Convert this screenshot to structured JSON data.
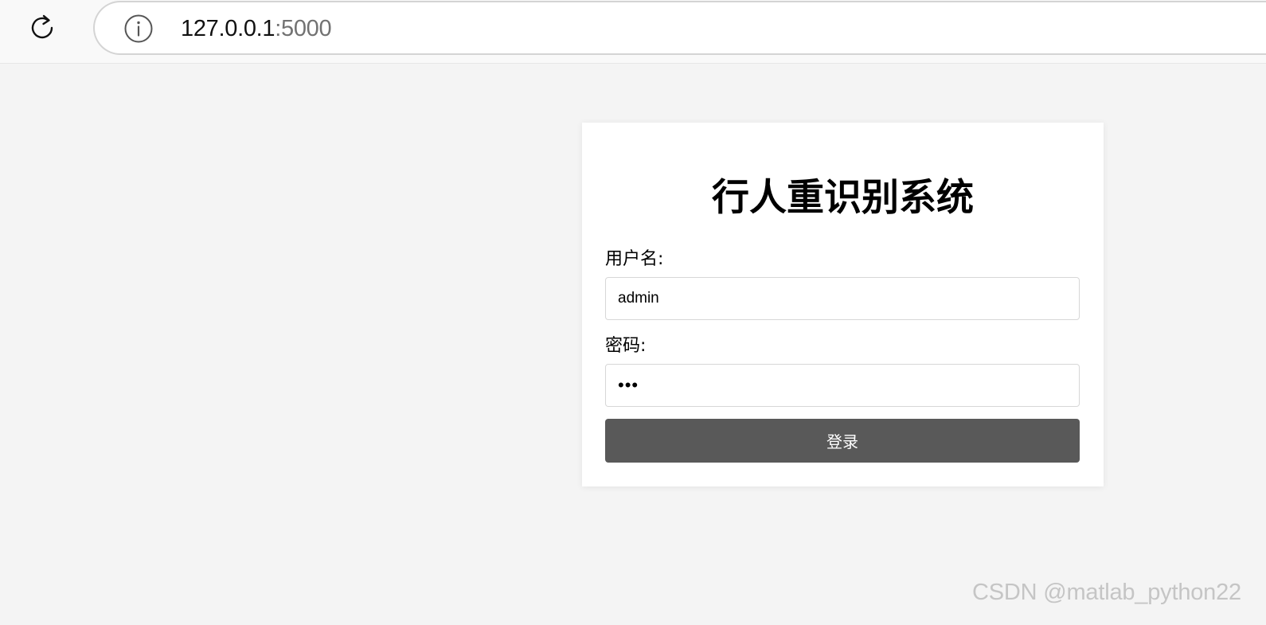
{
  "browser": {
    "url_host": "127.0.0.1",
    "url_port": ":5000",
    "reload_icon": "reload-icon",
    "info_icon": "info-icon"
  },
  "login": {
    "title": "行人重识别系统",
    "username_label": "用户名:",
    "username_value": "admin",
    "password_label": "密码:",
    "password_value": "abc",
    "submit_label": "登录"
  },
  "watermark": "CSDN @matlab_python22",
  "colors": {
    "page_bg": "#f4f4f4",
    "card_bg": "#ffffff",
    "button_bg": "#595959",
    "button_text": "#ffffff",
    "watermark": "#c5c5c5"
  }
}
